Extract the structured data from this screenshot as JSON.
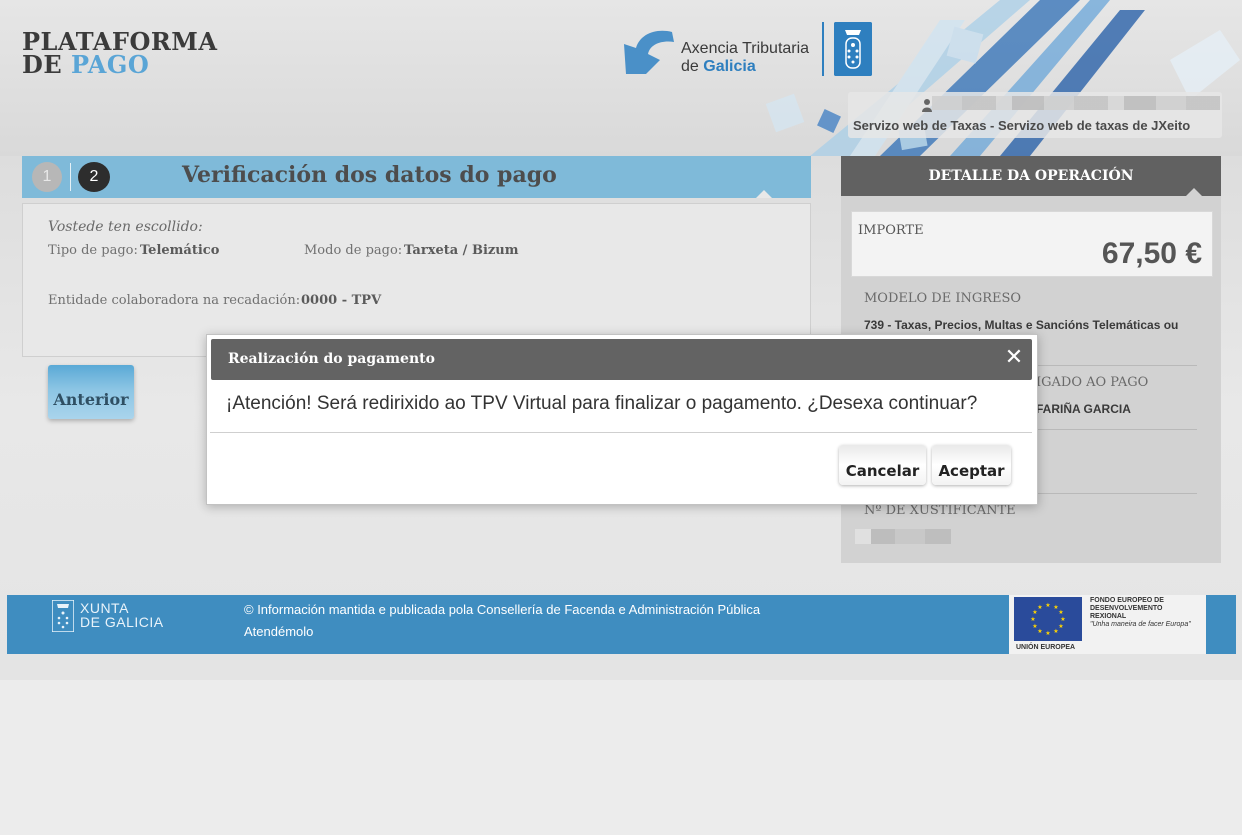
{
  "header": {
    "logo_line1": "PLATAFORMA",
    "logo_line2a": "DE ",
    "logo_line2b": "PAGO",
    "agency_line1": "Axencia Tributaria",
    "agency_line2a": "de ",
    "agency_line2b": "Galicia",
    "service": "Servizo web de Taxas - Servizo web de taxas de JXeito"
  },
  "steps": {
    "step1": "1",
    "step2": "2",
    "title": "Verificación dos datos do pago"
  },
  "summary": {
    "chosen": "Vostede ten escollido:",
    "payment_type_label": "Tipo de pago:",
    "payment_type_value": "Telemático",
    "payment_mode_label": "Modo de pago:",
    "payment_mode_value": "Tarxeta / Bizum",
    "entity_label": "Entidade colaboradora na recadación:",
    "entity_value": "0000 - TPV"
  },
  "buttons": {
    "previous": "Anterior"
  },
  "details": {
    "heading": "DETALLE DA OPERACIÓN",
    "amount_label": "IMPORTE",
    "amount_value": "67,50 €",
    "model_label": "MODELO DE INGRESO",
    "model_value": "739 - Taxas, Precios, Multas e Sancións Telemáticas ou",
    "obligee_label_visible": "IGADO AO PAGO",
    "obligee_value_visible": "FARIÑA GARCIA",
    "receipt_label": "Nº DE XUSTIFICANTE"
  },
  "modal": {
    "title": "Realización do pagamento",
    "close_icon": "close-icon",
    "message": "¡Atención! Será redirixido ao TPV Virtual para finalizar o pagamento. ¿Desexa continuar?",
    "cancel": "Cancelar",
    "accept": "Aceptar"
  },
  "footer": {
    "xunta_line1": "XUNTA",
    "xunta_line2": "DE GALICIA",
    "info": "© Información mantida e publicada pola Consellería de Facenda e Administración Pública",
    "link": "Atendémolo",
    "feder_1": "FONDO EUROPEO DE",
    "feder_2": "DESENVOLVEMENTO",
    "feder_3": "REXIONAL",
    "feder_motto": "\"Unha maneira de facer Europa\"",
    "eu_label": "UNIÓN EUROPEA"
  },
  "colors": {
    "accent_blue": "#7fbad9",
    "footer_blue": "#3f8dc0",
    "dark_header": "#616161"
  }
}
